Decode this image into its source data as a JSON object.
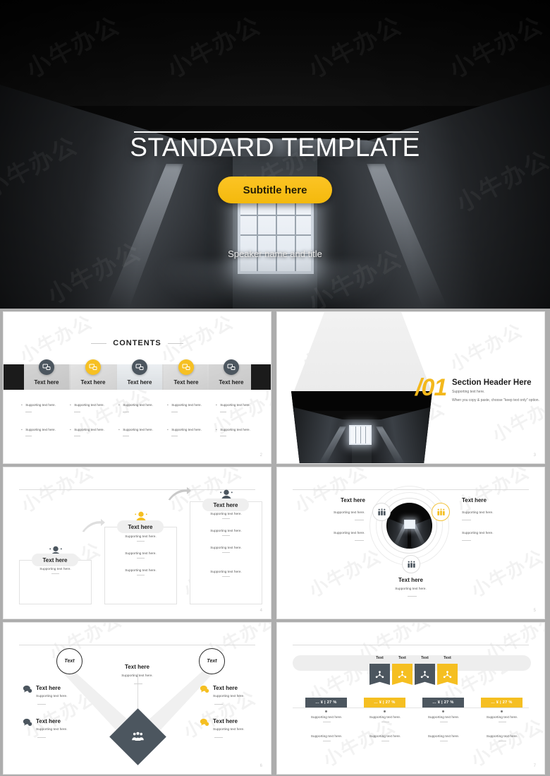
{
  "hero": {
    "title": "STANDARD TEMPLATE",
    "subtitle": "Subtitle here",
    "speaker": "Speaker name and title"
  },
  "watermark": {
    "text": "小牛办公"
  },
  "contents": {
    "title": "CONTENTS",
    "page_number": "2",
    "items": [
      {
        "label": "Text here",
        "icon": "device-chat-icon",
        "style": "dark"
      },
      {
        "label": "Text here",
        "icon": "device-chat-icon",
        "style": "gold"
      },
      {
        "label": "Text here",
        "icon": "device-chat-icon",
        "style": "dark"
      },
      {
        "label": "Text here",
        "icon": "device-chat-icon",
        "style": "gold"
      },
      {
        "label": "Text here",
        "icon": "device-chat-icon",
        "style": "dark"
      }
    ],
    "supporting": "Supporting text here."
  },
  "section": {
    "number": "/01",
    "heading": "Section Header Here",
    "sub1": "Supporting text here.",
    "sub2": "When you copy & paste, choose \"keep text only\" option.",
    "page_number": "3"
  },
  "steps": {
    "page_number": "4",
    "items": [
      {
        "label": "Text here",
        "icon": "user-group-icon",
        "style": "dark",
        "supporting": [
          "Supporting text here."
        ]
      },
      {
        "label": "Text here",
        "icon": "user-group-icon",
        "style": "gold",
        "supporting": [
          "Supporting text here.",
          "Supporting text here.",
          "Supporting text here."
        ]
      },
      {
        "label": "Text here",
        "icon": "user-group-icon",
        "style": "dark",
        "supporting": [
          "Supporting text here.",
          "Supporting text here.",
          "Supporting text here.",
          "Supporting text here."
        ]
      }
    ]
  },
  "circle": {
    "page_number": "5",
    "nodes": [
      {
        "heading": "Text here",
        "icon": "people-group-icon",
        "style": "dark",
        "supporting": [
          "Supporting text here.",
          "Supporting text here."
        ]
      },
      {
        "heading": "Text here",
        "icon": "people-group-icon",
        "style": "gold",
        "supporting": [
          "Supporting text here.",
          "Supporting text here."
        ]
      },
      {
        "heading": "Text here",
        "icon": "people-group-icon",
        "style": "dark",
        "supporting": [
          "Supporting text here."
        ]
      }
    ]
  },
  "vdiagram": {
    "page_number": "6",
    "circle_left": "Text",
    "circle_right": "Text",
    "center_heading": "Text here",
    "center_supporting": "Supporting text here.",
    "center_icon": "people-group-icon",
    "left_items": [
      {
        "heading": "Text here",
        "supporting": "Supporting text here.",
        "icon": "speech-bubble-icon",
        "style": "dark"
      },
      {
        "heading": "Text here",
        "supporting": "Supporting text here.",
        "icon": "speech-bubble-icon",
        "style": "dark"
      }
    ],
    "right_items": [
      {
        "heading": "Text here",
        "supporting": "Supporting text here.",
        "icon": "speech-bubble-icon",
        "style": "gold"
      },
      {
        "heading": "Text here",
        "supporting": "Supporting text here.",
        "icon": "speech-bubble-icon",
        "style": "gold"
      }
    ]
  },
  "banners": {
    "page_number": "7",
    "items": [
      {
        "label": "Text",
        "icon": "network-nodes-icon",
        "style": "dark",
        "value": "... ¥ | 27 %",
        "supporting": [
          "Supporting text here.",
          "Supporting text here."
        ]
      },
      {
        "label": "Text",
        "icon": "network-nodes-icon",
        "style": "gold",
        "value": "... ¥ | 27 %",
        "supporting": [
          "Supporting text here.",
          "Supporting text here."
        ]
      },
      {
        "label": "Text",
        "icon": "network-nodes-icon",
        "style": "dark",
        "value": "... ¥ | 27 %",
        "supporting": [
          "Supporting text here.",
          "Supporting text here."
        ]
      },
      {
        "label": "Text",
        "icon": "network-nodes-icon",
        "style": "gold",
        "value": "... ¥ | 27 %",
        "supporting": [
          "Supporting text here.",
          "Supporting text here."
        ]
      }
    ]
  },
  "colors": {
    "accent_gold": "#f5bf21",
    "slate": "#4c565f",
    "dark": "#1b1b1b"
  }
}
